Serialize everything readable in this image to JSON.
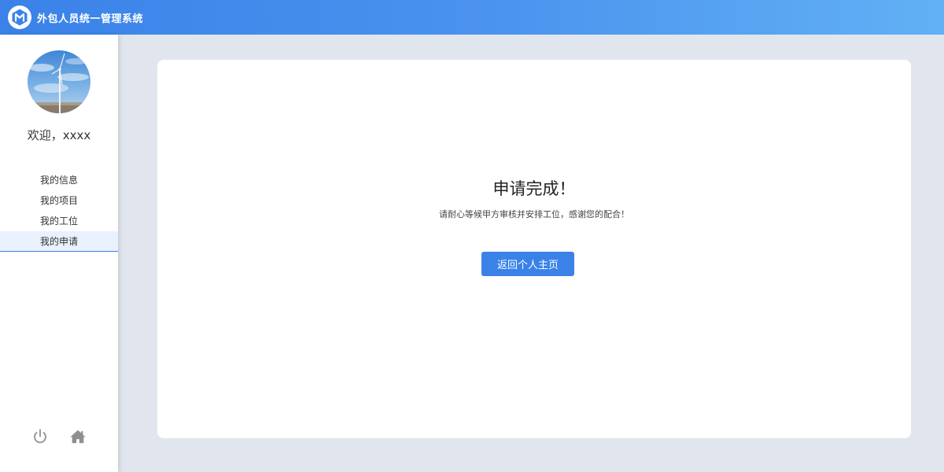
{
  "header": {
    "title": "外包人员统一管理系统",
    "logo_letter": "M"
  },
  "sidebar": {
    "welcome": "欢迎，xxxx",
    "items": [
      {
        "label": "我的信息"
      },
      {
        "label": "我的项目"
      },
      {
        "label": "我的工位"
      },
      {
        "label": "我的申请",
        "active": true
      }
    ],
    "bottom_icons": [
      "power-icon",
      "home-icon"
    ]
  },
  "main": {
    "title": "申请完成！",
    "subtitle": "请耐心等候甲方审核并安排工位，感谢您的配合！",
    "button_label": "返回个人主页"
  },
  "colors": {
    "accent": "#3a82e8",
    "header_gradient_end": "#62b0f5",
    "background": "#e1e6ee"
  }
}
